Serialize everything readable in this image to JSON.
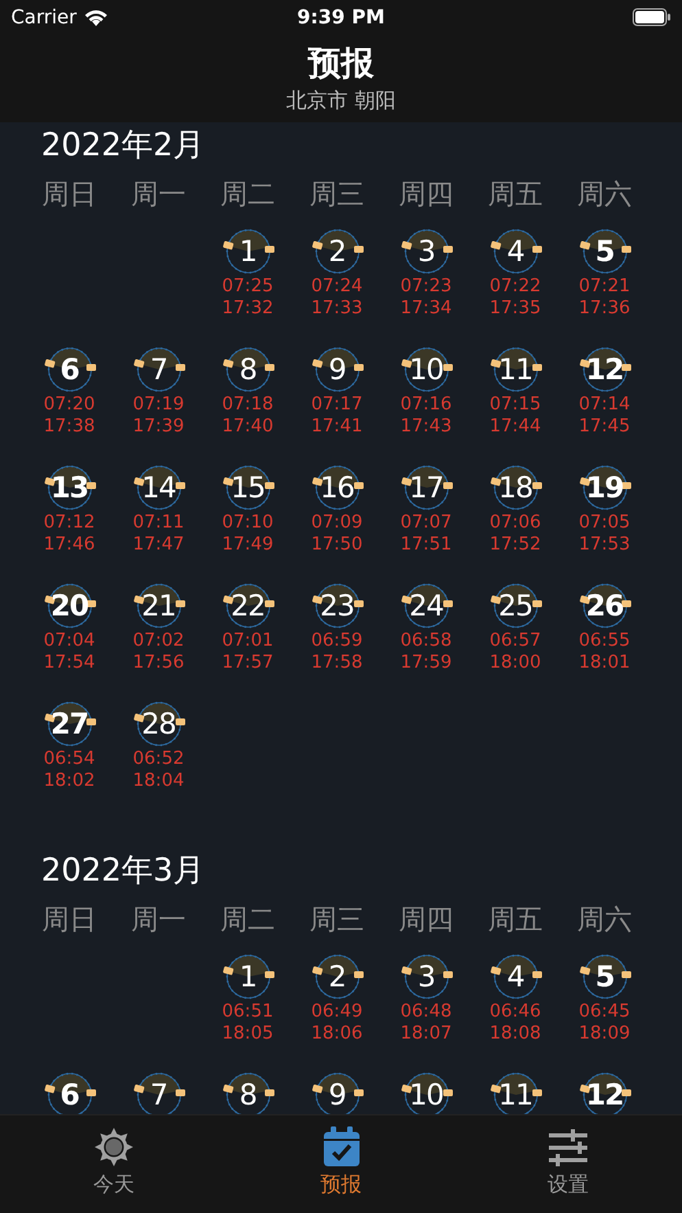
{
  "status_bar": {
    "carrier": "Carrier",
    "time": "9:39 PM"
  },
  "header": {
    "title": "预报",
    "subtitle": "北京市 朝阳"
  },
  "months": [
    {
      "title": "2022年2月",
      "weekdays": [
        "周日",
        "周一",
        "周二",
        "周三",
        "周四",
        "周五",
        "周六"
      ],
      "days": [
        {
          "kind": "blank"
        },
        {
          "kind": "blank"
        },
        {
          "kind": "day",
          "day": "1",
          "sunrise": "07:25",
          "sunset": "17:32"
        },
        {
          "kind": "day",
          "day": "2",
          "sunrise": "07:24",
          "sunset": "17:33"
        },
        {
          "kind": "day",
          "day": "3",
          "sunrise": "07:23",
          "sunset": "17:34"
        },
        {
          "kind": "day",
          "day": "4",
          "sunrise": "07:22",
          "sunset": "17:35"
        },
        {
          "kind": "day",
          "day": "5",
          "sunrise": "07:21",
          "sunset": "17:36"
        },
        {
          "kind": "day",
          "day": "6",
          "sunrise": "07:20",
          "sunset": "17:38"
        },
        {
          "kind": "day",
          "day": "7",
          "sunrise": "07:19",
          "sunset": "17:39"
        },
        {
          "kind": "day",
          "day": "8",
          "sunrise": "07:18",
          "sunset": "17:40"
        },
        {
          "kind": "day",
          "day": "9",
          "sunrise": "07:17",
          "sunset": "17:41"
        },
        {
          "kind": "day",
          "day": "10",
          "sunrise": "07:16",
          "sunset": "17:43"
        },
        {
          "kind": "day",
          "day": "11",
          "sunrise": "07:15",
          "sunset": "17:44"
        },
        {
          "kind": "day",
          "day": "12",
          "sunrise": "07:14",
          "sunset": "17:45"
        },
        {
          "kind": "day",
          "day": "13",
          "sunrise": "07:12",
          "sunset": "17:46"
        },
        {
          "kind": "day",
          "day": "14",
          "sunrise": "07:11",
          "sunset": "17:47"
        },
        {
          "kind": "day",
          "day": "15",
          "sunrise": "07:10",
          "sunset": "17:49"
        },
        {
          "kind": "day",
          "day": "16",
          "sunrise": "07:09",
          "sunset": "17:50"
        },
        {
          "kind": "day",
          "day": "17",
          "sunrise": "07:07",
          "sunset": "17:51"
        },
        {
          "kind": "day",
          "day": "18",
          "sunrise": "07:06",
          "sunset": "17:52"
        },
        {
          "kind": "day",
          "day": "19",
          "sunrise": "07:05",
          "sunset": "17:53"
        },
        {
          "kind": "day",
          "day": "20",
          "sunrise": "07:04",
          "sunset": "17:54"
        },
        {
          "kind": "day",
          "day": "21",
          "sunrise": "07:02",
          "sunset": "17:56"
        },
        {
          "kind": "day",
          "day": "22",
          "sunrise": "07:01",
          "sunset": "17:57"
        },
        {
          "kind": "day",
          "day": "23",
          "sunrise": "06:59",
          "sunset": "17:58"
        },
        {
          "kind": "day",
          "day": "24",
          "sunrise": "06:58",
          "sunset": "17:59"
        },
        {
          "kind": "day",
          "day": "25",
          "sunrise": "06:57",
          "sunset": "18:00"
        },
        {
          "kind": "day",
          "day": "26",
          "sunrise": "06:55",
          "sunset": "18:01"
        },
        {
          "kind": "day",
          "day": "27",
          "sunrise": "06:54",
          "sunset": "18:02"
        },
        {
          "kind": "day",
          "day": "28",
          "sunrise": "06:52",
          "sunset": "18:04"
        }
      ]
    },
    {
      "title": "2022年3月",
      "weekdays": [
        "周日",
        "周一",
        "周二",
        "周三",
        "周四",
        "周五",
        "周六"
      ],
      "days": [
        {
          "kind": "blank"
        },
        {
          "kind": "blank"
        },
        {
          "kind": "day",
          "day": "1",
          "sunrise": "06:51",
          "sunset": "18:05"
        },
        {
          "kind": "day",
          "day": "2",
          "sunrise": "06:49",
          "sunset": "18:06"
        },
        {
          "kind": "day",
          "day": "3",
          "sunrise": "06:48",
          "sunset": "18:07"
        },
        {
          "kind": "day",
          "day": "4",
          "sunrise": "06:46",
          "sunset": "18:08"
        },
        {
          "kind": "day",
          "day": "5",
          "sunrise": "06:45",
          "sunset": "18:09"
        },
        {
          "kind": "day",
          "day": "6"
        },
        {
          "kind": "day",
          "day": "7"
        },
        {
          "kind": "day",
          "day": "8"
        },
        {
          "kind": "day",
          "day": "9"
        },
        {
          "kind": "day",
          "day": "10"
        },
        {
          "kind": "day",
          "day": "11"
        },
        {
          "kind": "day",
          "day": "12"
        }
      ]
    }
  ],
  "tabs": [
    {
      "label": "今天",
      "selected": false
    },
    {
      "label": "预报",
      "selected": true
    },
    {
      "label": "设置",
      "selected": false
    }
  ]
}
